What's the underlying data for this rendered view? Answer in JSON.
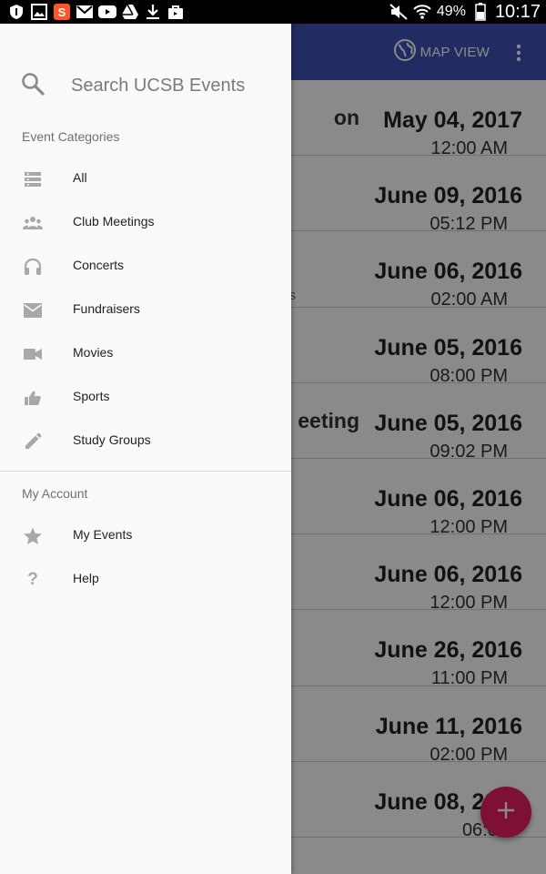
{
  "status_bar": {
    "battery": "49%",
    "time": "10:17"
  },
  "app_bar": {
    "map_view_label": "MAP VIEW"
  },
  "events": [
    {
      "title": "on",
      "subtitle": "",
      "date": "May 04, 2017",
      "time": "12:00 AM"
    },
    {
      "title": "",
      "subtitle": "",
      "date": "June 09, 2016",
      "time": "05:12 PM"
    },
    {
      "title": "",
      "subtitle": "s",
      "date": "June 06, 2016",
      "time": "02:00 AM"
    },
    {
      "title": "",
      "subtitle": "",
      "date": "June 05, 2016",
      "time": "08:00 PM"
    },
    {
      "title": "eeting",
      "subtitle": "",
      "date": "June 05, 2016",
      "time": "09:02 PM"
    },
    {
      "title": "",
      "subtitle": "",
      "date": "June 06, 2016",
      "time": "12:00 PM"
    },
    {
      "title": "",
      "subtitle": "",
      "date": "June 06, 2016",
      "time": "12:00 PM"
    },
    {
      "title": "",
      "subtitle": "",
      "date": "June 26, 2016",
      "time": "11:00 PM"
    },
    {
      "title": "",
      "subtitle": "",
      "date": "June 11, 2016",
      "time": "02:00 PM"
    },
    {
      "title": "",
      "subtitle": "",
      "date": "June 08, 2016",
      "time": "06:00"
    }
  ],
  "drawer": {
    "search_placeholder": "Search UCSB Events",
    "categories_header": "Event Categories",
    "categories": [
      {
        "label": "All",
        "icon": "list-icon"
      },
      {
        "label": "Club Meetings",
        "icon": "group-icon"
      },
      {
        "label": "Concerts",
        "icon": "headphones-icon"
      },
      {
        "label": "Fundraisers",
        "icon": "mail-icon"
      },
      {
        "label": "Movies",
        "icon": "videocam-icon"
      },
      {
        "label": "Sports",
        "icon": "thumb-up-icon"
      },
      {
        "label": "Study Groups",
        "icon": "pencil-icon"
      }
    ],
    "account_header": "My Account",
    "account_items": [
      {
        "label": "My Events",
        "icon": "star-icon"
      },
      {
        "label": "Help",
        "icon": "help-icon"
      }
    ]
  },
  "colors": {
    "app_bar": "#3f51b5",
    "fab": "#e91e63",
    "drawer_bg": "#fafafa",
    "icon_gray": "#a8a8a8"
  }
}
